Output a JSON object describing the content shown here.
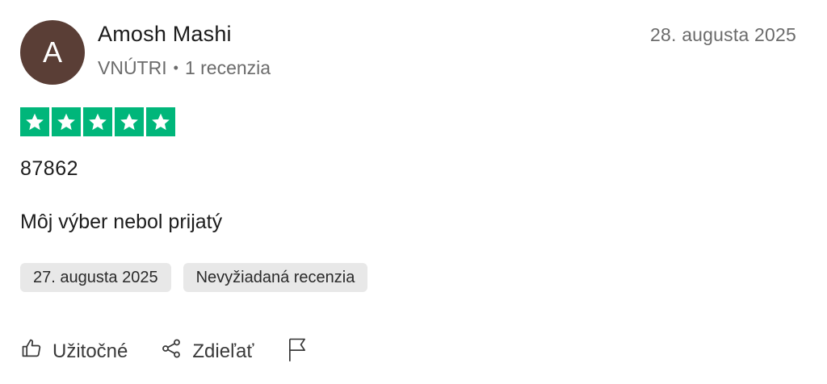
{
  "reviewer": {
    "avatar_initial": "A",
    "name": "Amosh Mashi",
    "country": "VNÚTRI",
    "separator": "•",
    "review_count": "1 recenzia"
  },
  "review": {
    "date_posted": "28. augusta 2025",
    "rating": 5,
    "rating_max": 5,
    "title": "87862",
    "text": "Môj výber nebol prijatý",
    "tags": [
      "27. augusta 2025",
      "Nevyžiadaná recenzia"
    ]
  },
  "actions": {
    "useful_label": "Užitočné",
    "share_label": "Zdieľať",
    "report_icon": "flag-icon"
  },
  "colors": {
    "avatar_bg": "#5a3e36",
    "star_green": "#00b67a",
    "tag_bg": "#e8e8e8"
  }
}
